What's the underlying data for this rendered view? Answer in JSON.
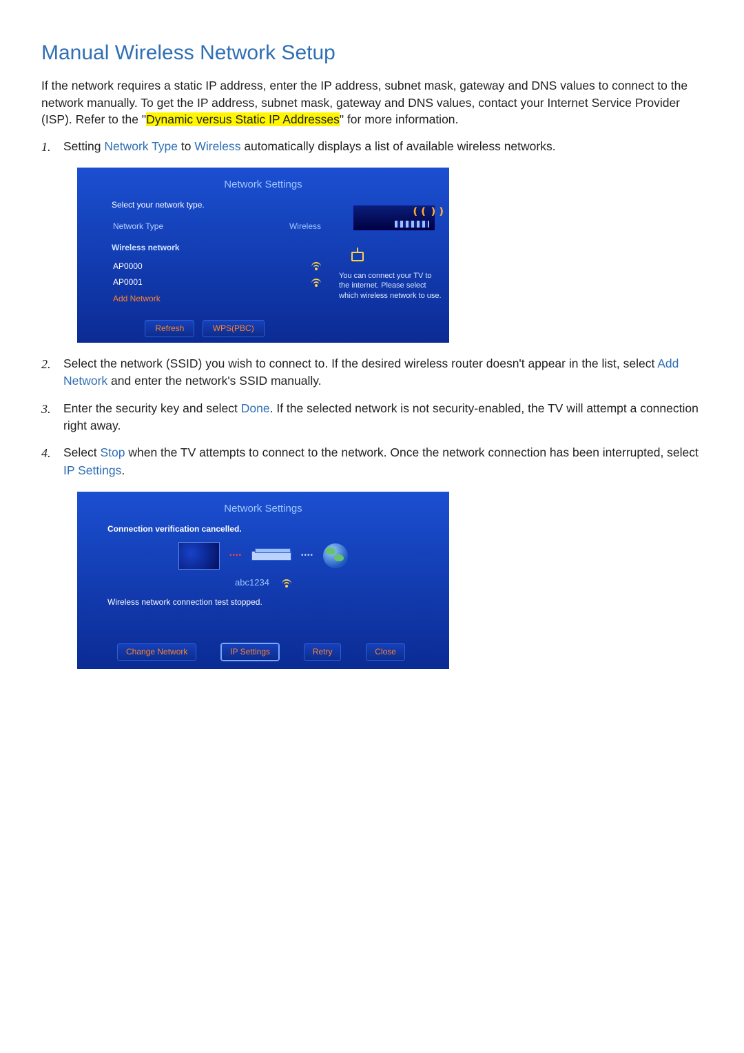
{
  "title": "Manual Wireless Network Setup",
  "intro": {
    "part1": "If the network requires a static IP address, enter the IP address, subnet mask, gateway and DNS values to connect to the network manually. To get the IP address, subnet mask, gateway and DNS values, contact your Internet Service Provider (ISP). Refer to the \"",
    "link": "Dynamic versus Static IP Addresses",
    "part2": "\" for more information."
  },
  "steps": {
    "s1": {
      "a": "Setting ",
      "k1": "Network Type",
      "b": " to ",
      "k2": "Wireless",
      "c": " automatically displays a list of available wireless networks."
    },
    "s2": {
      "a": "Select the network (SSID) you wish to connect to. If the desired wireless router doesn't appear in the list, select ",
      "k1": "Add Network",
      "b": " and enter the network's SSID manually."
    },
    "s3": {
      "a": "Enter the security key and select ",
      "k1": "Done",
      "b": ". If the selected network is not security-enabled, the TV will attempt a connection right away."
    },
    "s4": {
      "a": "Select ",
      "k1": "Stop",
      "b": " when the TV attempts to connect to the network. Once the network connection has been interrupted, select ",
      "k2": "IP Settings",
      "c": "."
    }
  },
  "tv1": {
    "title": "Network Settings",
    "instr": "Select your network type.",
    "row_type_label": "Network Type",
    "row_type_value": "Wireless",
    "section_hdr": "Wireless network",
    "ssid0": "AP0000",
    "ssid1": "AP0001",
    "addnet": "Add Network",
    "right_text": "You can connect your TV to the internet. Please select which wireless network to use.",
    "btn_refresh": "Refresh",
    "btn_wps": "WPS(PBC)"
  },
  "tv2": {
    "title": "Network Settings",
    "instr": "Connection verification cancelled.",
    "netname": "abc1234",
    "stopped": "Wireless network connection test stopped.",
    "btn_change": "Change Network",
    "btn_ip": "IP Settings",
    "btn_retry": "Retry",
    "btn_close": "Close"
  }
}
